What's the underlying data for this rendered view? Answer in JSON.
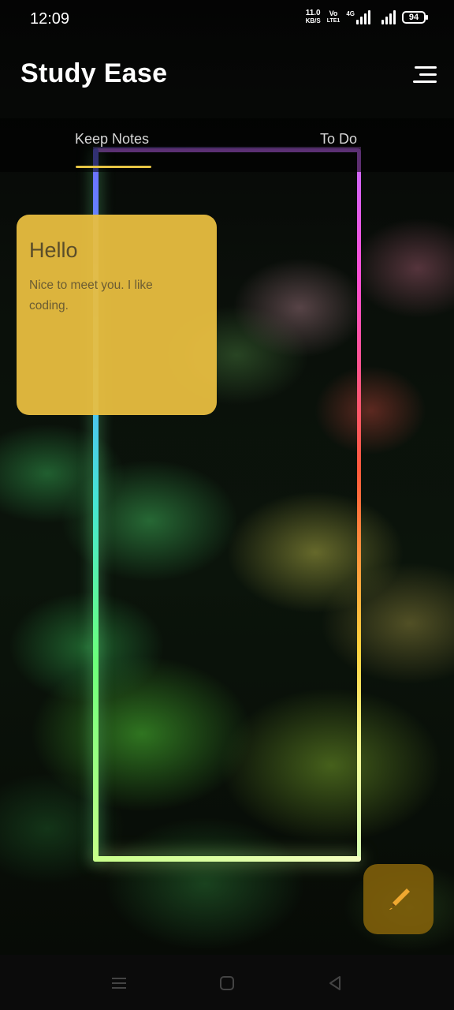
{
  "status_bar": {
    "time": "12:09",
    "net_speed_value": "11.0",
    "net_speed_unit": "KB/S",
    "volte_top": "Vo",
    "volte_bottom": "LTE1",
    "network_type": "4G",
    "battery_level": "94"
  },
  "header": {
    "title": "Study Ease",
    "menu_icon": "menu-icon"
  },
  "tabs": [
    {
      "label": "Keep Notes",
      "selected": true
    },
    {
      "label": "To Do",
      "selected": false
    }
  ],
  "notes": [
    {
      "title": "Hello",
      "body": "Nice to meet you. I like coding.",
      "color": "#E8BE40"
    }
  ],
  "fab": {
    "icon": "pen-icon",
    "color": "#87640A"
  },
  "nav_bar": {
    "icons": [
      "recents-menu-icon",
      "home-icon",
      "back-icon"
    ]
  },
  "colors": {
    "accent": "#E6C544",
    "note": "#E8BE40"
  }
}
